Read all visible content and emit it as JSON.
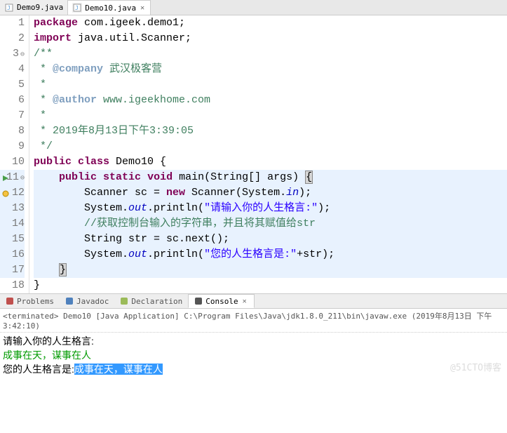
{
  "tabs": [
    {
      "label": "Demo9.java",
      "active": false
    },
    {
      "label": "Demo10.java",
      "active": true
    }
  ],
  "code": {
    "lines": [
      {
        "n": "1",
        "fold": "",
        "mark": "",
        "hl": false,
        "segs": [
          [
            "kw-p",
            "package"
          ],
          [
            "plain",
            " com.igeek.demo1;"
          ]
        ]
      },
      {
        "n": "2",
        "fold": "",
        "mark": "",
        "hl": false,
        "segs": [
          [
            "kw-p",
            "import"
          ],
          [
            "plain",
            " java.util.Scanner;"
          ]
        ]
      },
      {
        "n": "3",
        "fold": "⊖",
        "mark": "",
        "hl": false,
        "segs": [
          [
            "comment",
            "/**"
          ]
        ]
      },
      {
        "n": "4",
        "fold": "",
        "mark": "",
        "hl": false,
        "segs": [
          [
            "comment",
            " * "
          ],
          [
            "doctag",
            "@company"
          ],
          [
            "comment",
            " 武汉极客营"
          ]
        ]
      },
      {
        "n": "5",
        "fold": "",
        "mark": "",
        "hl": false,
        "segs": [
          [
            "comment",
            " * "
          ]
        ]
      },
      {
        "n": "6",
        "fold": "",
        "mark": "",
        "hl": false,
        "segs": [
          [
            "comment",
            " * "
          ],
          [
            "doctag",
            "@author"
          ],
          [
            "comment",
            " www.igeekhome.com"
          ]
        ]
      },
      {
        "n": "7",
        "fold": "",
        "mark": "",
        "hl": false,
        "segs": [
          [
            "comment",
            " *"
          ]
        ]
      },
      {
        "n": "8",
        "fold": "",
        "mark": "",
        "hl": false,
        "segs": [
          [
            "comment",
            " * 2019年8月13日下午3:39:05"
          ]
        ]
      },
      {
        "n": "9",
        "fold": "",
        "mark": "",
        "hl": false,
        "segs": [
          [
            "comment",
            " */"
          ]
        ]
      },
      {
        "n": "10",
        "fold": "",
        "mark": "",
        "hl": false,
        "segs": [
          [
            "kw-p",
            "public"
          ],
          [
            "plain",
            " "
          ],
          [
            "kw-p",
            "class"
          ],
          [
            "plain",
            " Demo10 {"
          ]
        ]
      },
      {
        "n": "11",
        "fold": "⊖",
        "mark": "▶",
        "hl": true,
        "segs": [
          [
            "plain",
            "    "
          ],
          [
            "kw-p",
            "public"
          ],
          [
            "plain",
            " "
          ],
          [
            "kw-p",
            "static"
          ],
          [
            "plain",
            " "
          ],
          [
            "kw-p",
            "void"
          ],
          [
            "plain",
            " main(String[] args) "
          ],
          [
            "bracket-hl",
            "{"
          ]
        ]
      },
      {
        "n": "12",
        "fold": "",
        "mark": "●",
        "hl": true,
        "segs": [
          [
            "plain",
            "        Scanner sc = "
          ],
          [
            "kw-p",
            "new"
          ],
          [
            "plain",
            " Scanner(System."
          ],
          [
            "static-it",
            "in"
          ],
          [
            "plain",
            ");"
          ]
        ]
      },
      {
        "n": "13",
        "fold": "",
        "mark": "",
        "hl": true,
        "segs": [
          [
            "plain",
            "        System."
          ],
          [
            "static-it",
            "out"
          ],
          [
            "plain",
            ".println("
          ],
          [
            "str",
            "\"请输入你的人生格言:\""
          ],
          [
            "plain",
            ");"
          ]
        ]
      },
      {
        "n": "14",
        "fold": "",
        "mark": "",
        "hl": true,
        "segs": [
          [
            "plain",
            "        "
          ],
          [
            "comment",
            "//获取控制台输入的字符串，并且将其赋值给str"
          ]
        ]
      },
      {
        "n": "15",
        "fold": "",
        "mark": "",
        "hl": true,
        "segs": [
          [
            "plain",
            "        String str = sc.next();"
          ]
        ]
      },
      {
        "n": "16",
        "fold": "",
        "mark": "",
        "hl": true,
        "segs": [
          [
            "plain",
            "        System."
          ],
          [
            "static-it",
            "out"
          ],
          [
            "plain",
            ".println("
          ],
          [
            "str",
            "\"您的人生格言是:\""
          ],
          [
            "plain",
            "+str);"
          ]
        ]
      },
      {
        "n": "17",
        "fold": "",
        "mark": "",
        "hl": true,
        "segs": [
          [
            "plain",
            "    "
          ],
          [
            "bracket-hl",
            "}"
          ]
        ]
      },
      {
        "n": "18",
        "fold": "",
        "mark": "",
        "hl": false,
        "segs": [
          [
            "plain",
            "}"
          ]
        ]
      }
    ]
  },
  "panel_tabs": [
    {
      "label": "Problems",
      "icon": "problems-icon",
      "active": false
    },
    {
      "label": "Javadoc",
      "icon": "javadoc-icon",
      "active": false
    },
    {
      "label": "Declaration",
      "icon": "decl-icon",
      "active": false
    },
    {
      "label": "Console",
      "icon": "console-icon",
      "active": true
    }
  ],
  "terminated_line": "<terminated> Demo10 [Java Application] C:\\Program Files\\Java\\jdk1.8.0_211\\bin\\javaw.exe (2019年8月13日 下午3:42:10)",
  "console": {
    "line1": "请输入你的人生格言:",
    "line2": "成事在天，谋事在人",
    "line3_prefix": "您的人生格言是:",
    "line3_selected": "成事在天，谋事在人"
  },
  "watermark": "@51CTO博客"
}
